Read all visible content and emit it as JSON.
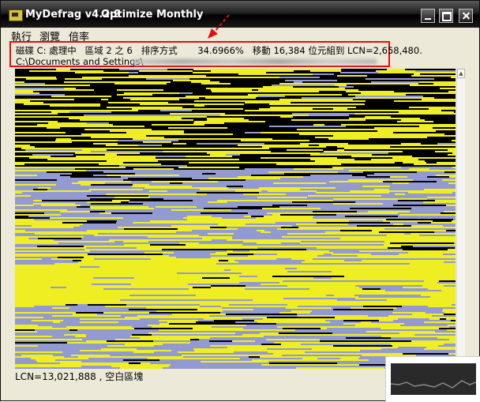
{
  "window": {
    "app_name": "MyDefrag v4.2.9",
    "script_name": "Optimize Monthly"
  },
  "menu": [
    "執行",
    "瀏覽",
    "倍率"
  ],
  "status": {
    "line1": "磁碟 C: 處理中   區域 2 之 6   排序方式       34.6966%   移動 16,384 位元組到 LCN=2,658,480.",
    "path_prefix": "C:\\Documents and Settings\\"
  },
  "footer": {
    "status_text": "LCN=13,021,888 , 空白區塊"
  },
  "disk_map": {
    "colors": {
      "free_space": "#000000",
      "unfragmented": "#eeee22",
      "fragmented_selected": "#939ad2"
    }
  }
}
